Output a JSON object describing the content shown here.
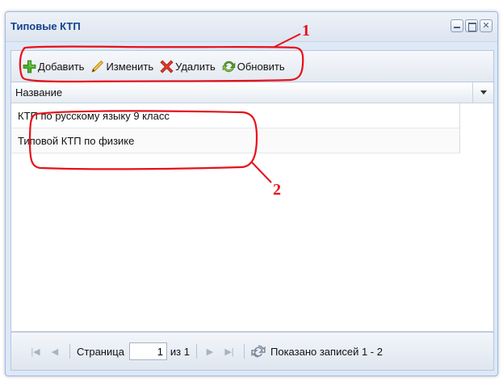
{
  "window": {
    "title": "Типовые КТП",
    "controls": [
      "minimize-icon",
      "maximize-icon",
      "close-icon"
    ]
  },
  "toolbar": {
    "add_label": "Добавить",
    "edit_label": "Изменить",
    "delete_label": "Удалить",
    "refresh_label": "Обновить"
  },
  "grid": {
    "column_header": "Название",
    "rows": [
      "КТП по русскому языку 9 класс",
      "Типовой КТП по физике"
    ]
  },
  "pager": {
    "page_label": "Страница",
    "page_value": "1",
    "of_label": "из 1",
    "records_label": "Показано записей 1 - 2"
  },
  "annotations": {
    "label_1": "1",
    "label_2": "2",
    "color": "#e8101a"
  }
}
